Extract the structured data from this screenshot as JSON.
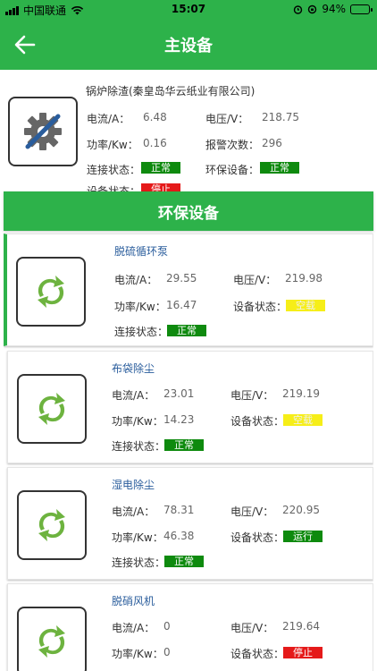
{
  "status_bar": {
    "carrier": "中国联通",
    "time": "15:07",
    "battery": "94%",
    "battery_level": 0.94
  },
  "nav": {
    "title": "主设备"
  },
  "main_device": {
    "name": "锅炉除渣(秦皇岛华云纸业有限公司)",
    "current_label": "电流/A：",
    "current": "6.48",
    "voltage_label": "电压/V：",
    "voltage": "218.75",
    "power_label": "功率/Kw：",
    "power": "0.16",
    "alarm_label": "报警次数：",
    "alarm_count": "296",
    "conn_label": "连接状态：",
    "conn_status": "正常",
    "env_label": "环保设备：",
    "env_status": "正常",
    "device_label": "设备状态：",
    "device_status": "停止"
  },
  "section": {
    "title": "环保设备"
  },
  "devices": [
    {
      "name": "脱硫循环泵",
      "current_label": "电流/A：",
      "current": "29.55",
      "voltage_label": "电压/V：",
      "voltage": "219.98",
      "power_label": "功率/Kw：",
      "power": "16.47",
      "status_label": "设备状态：",
      "status": "空载",
      "conn_label": "连接状态：",
      "conn": "正常"
    },
    {
      "name": "布袋除尘",
      "current_label": "电流/A：",
      "current": "23.01",
      "voltage_label": "电压/V：",
      "voltage": "219.19",
      "power_label": "功率/Kw：",
      "power": "14.23",
      "status_label": "设备状态：",
      "status": "空载",
      "conn_label": "连接状态：",
      "conn": "正常"
    },
    {
      "name": "湿电除尘",
      "current_label": "电流/A：",
      "current": "78.31",
      "voltage_label": "电压/V：",
      "voltage": "220.95",
      "power_label": "功率/Kw：",
      "power": "46.38",
      "status_label": "设备状态：",
      "status": "运行",
      "conn_label": "连接状态：",
      "conn": "正常"
    },
    {
      "name": "脱硝风机",
      "current_label": "电流/A：",
      "current": "0",
      "voltage_label": "电压/V：",
      "voltage": "219.64",
      "power_label": "功率/Kw：",
      "power": "0",
      "status_label": "设备状态：",
      "status": "停止"
    }
  ],
  "colors": {
    "brand_green": "#2db24a",
    "status_ok": "#0e8a0e",
    "status_idle": "#f6ee18",
    "status_stop": "#e51a1a",
    "device_name": "#2a5d9c"
  },
  "icons": {
    "main_device": "gear-icon",
    "env_device": "refresh-cycle-icon",
    "back": "arrow-left-icon"
  }
}
